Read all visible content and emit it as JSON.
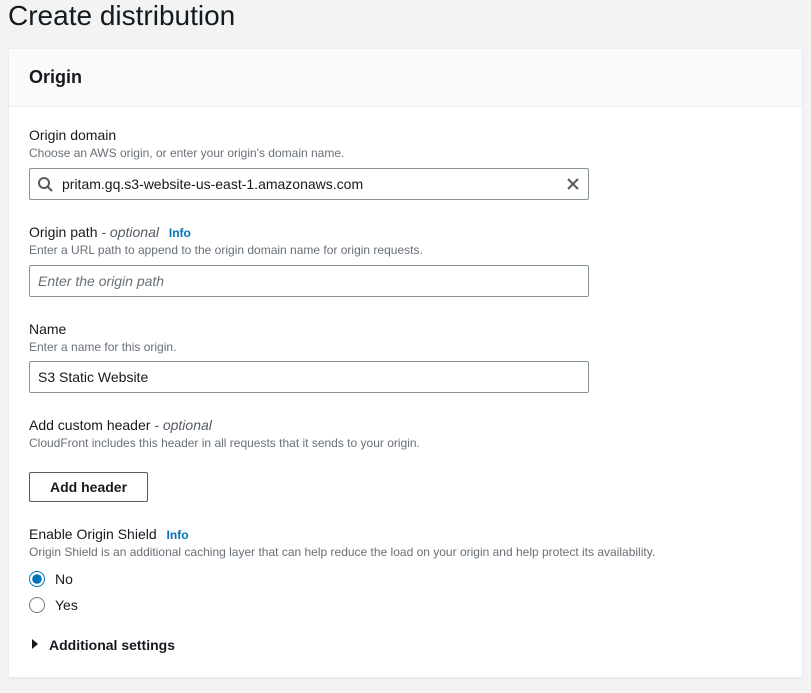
{
  "page": {
    "title": "Create distribution"
  },
  "panel": {
    "title": "Origin"
  },
  "origin_domain": {
    "label": "Origin domain",
    "desc": "Choose an AWS origin, or enter your origin's domain name.",
    "value": "pritam.gq.s3-website-us-east-1.amazonaws.com"
  },
  "origin_path": {
    "label": "Origin path",
    "optional": " - optional",
    "info": "Info",
    "desc": "Enter a URL path to append to the origin domain name for origin requests.",
    "placeholder": "Enter the origin path",
    "value": ""
  },
  "name": {
    "label": "Name",
    "desc": "Enter a name for this origin.",
    "value": "S3 Static Website"
  },
  "custom_header": {
    "label": "Add custom header",
    "optional": " - optional",
    "desc": "CloudFront includes this header in all requests that it sends to your origin.",
    "button": "Add header"
  },
  "origin_shield": {
    "label": "Enable Origin Shield",
    "info": "Info",
    "desc": "Origin Shield is an additional caching layer that can help reduce the load on your origin and help protect its availability.",
    "options": {
      "no": "No",
      "yes": "Yes"
    },
    "selected": "no"
  },
  "additional": {
    "label": "Additional settings"
  }
}
